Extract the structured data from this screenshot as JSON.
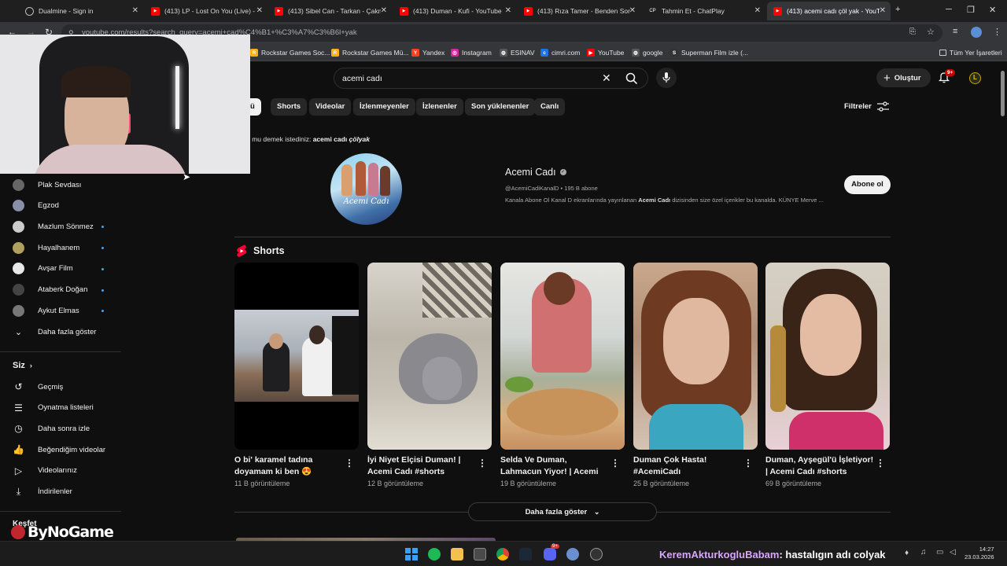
{
  "browser": {
    "tabs": [
      {
        "title": "Dualmine - Sign in",
        "favicon": "globe-icon",
        "active": false
      },
      {
        "title": "(413) LP - Lost On You (Live) - Y",
        "favicon": "youtube-icon",
        "active": false
      },
      {
        "title": "(413) Sibel Can - Tarkan - Çakm",
        "favicon": "youtube-icon",
        "active": false
      },
      {
        "title": "(413) Duman - Kufi - YouTube",
        "favicon": "youtube-icon",
        "active": false
      },
      {
        "title": "(413) Rıza Tamer - Benden Son",
        "favicon": "youtube-icon",
        "active": false
      },
      {
        "title": "Tahmin Et - ChatPlay",
        "favicon": "chatplay-icon",
        "favicon_text": "CP",
        "active": false
      },
      {
        "title": "(413) acemi cadı çöl yak - YouT",
        "favicon": "youtube-icon",
        "active": true
      }
    ],
    "url": "youtube.com/results?search_query=acemi+cad%C4%B1+%C3%A7%C3%B6l+yak",
    "bookmarks": [
      {
        "label": "Rockstar Games Soc...",
        "icon": "rockstar-icon",
        "icon_text": "R",
        "color": "#fcaf17"
      },
      {
        "label": "Rockstar Games Mü...",
        "icon": "rockstar-icon",
        "icon_text": "R",
        "color": "#fcaf17"
      },
      {
        "label": "Yandex",
        "icon": "yandex-icon",
        "icon_text": "Y",
        "color": "#fc3f1d"
      },
      {
        "label": "Instagram",
        "icon": "instagram-icon",
        "icon_text": "◎",
        "color": "#d6249f"
      },
      {
        "label": "ESINAV",
        "icon": "globe-icon",
        "icon_text": "◍",
        "color": "#555555"
      },
      {
        "label": "cimri.com",
        "icon": "cimri-icon",
        "icon_text": "c",
        "color": "#1a73e8"
      },
      {
        "label": "YouTube",
        "icon": "youtube-icon",
        "icon_text": "▶",
        "color": "#ff0000"
      },
      {
        "label": "google",
        "icon": "globe-icon",
        "icon_text": "◍",
        "color": "#555555"
      },
      {
        "label": "Superman Film izle (...",
        "icon": "superman-icon",
        "icon_text": "S",
        "color": "#333333"
      }
    ],
    "all_bookmarks": "Tüm Yer İşaretleri"
  },
  "youtube": {
    "search_query": "acemi cadı",
    "create_label": "Oluştur",
    "notif_badge": "9+",
    "filters": [
      {
        "label": "Tümü",
        "selected": true
      },
      {
        "label": "Shorts"
      },
      {
        "label": "Videolar"
      },
      {
        "label": "İzlenmeyenler"
      },
      {
        "label": "İzlenenler"
      },
      {
        "label": "Son yüklenenler"
      },
      {
        "label": "Canlı"
      }
    ],
    "filters_button": "Filtreler",
    "did_you_mean_prefix": "Bunu mu demek istediniz: ",
    "did_you_mean_plain": "acemi cadı ",
    "did_you_mean_italic": "çölyak",
    "channel": {
      "name": "Acemi Cadı",
      "handle_line": "@AcemiCadiKanalD • 195 B abone",
      "desc_before": "Kanala Abone Ol Kanal D ekranlarında yayınlanan ",
      "desc_bold": "Acemi Cadı",
      "desc_after": " dizisinden size özel içerikler bu kanalda. KÜNYE Merve ...",
      "subscribe_label": "Abone ol",
      "avatar_text": "Acemi Cadı"
    },
    "shorts_header": "Shorts",
    "shorts": [
      {
        "title": "O bi' karamel tadına doyamam ki ben 😍 Acem...",
        "views": "11 B görüntüleme"
      },
      {
        "title": "İyi Niyet Elçisi Duman! | Acemi Cadı #shorts",
        "views": "12 B görüntüleme"
      },
      {
        "title": "Selda Ve Duman, Lahmacun Yiyor! | Acemi Cadı #shorts",
        "views": "19 B görüntüleme"
      },
      {
        "title": "Duman Çok Hasta! #AcemiCadı",
        "views": "25 B görüntüleme"
      },
      {
        "title": "Duman, Ayşegül'ü İşletiyor! | Acemi Cadı #shorts",
        "views": "69 B görüntüleme"
      }
    ],
    "show_more": "Daha fazla göster",
    "sidebar": {
      "subscriptions": [
        {
          "name": "Plak Sevdası",
          "color": "#666666",
          "new": false
        },
        {
          "name": "Egzod",
          "color": "#8a8fa8",
          "new": false
        },
        {
          "name": "Mazlum Sönmez",
          "color": "#cccccc",
          "new": true
        },
        {
          "name": "Hayalhanem",
          "color": "#b0a060",
          "new": true
        },
        {
          "name": "Avşar Film",
          "color": "#e8e8e8",
          "new": true
        },
        {
          "name": "Ataberk Doğan",
          "color": "#444444",
          "new": true
        },
        {
          "name": "Aykut Elmas",
          "color": "#777777",
          "new": true
        }
      ],
      "show_more": "Daha fazla göster",
      "you_header": "Siz",
      "you_items": [
        {
          "label": "Geçmiş",
          "icon": "history-icon"
        },
        {
          "label": "Oynatma listeleri",
          "icon": "playlist-icon"
        },
        {
          "label": "Daha sonra izle",
          "icon": "clock-icon"
        },
        {
          "label": "Beğendiğim videolar",
          "icon": "thumbs-up-icon"
        },
        {
          "label": "Videolarınız",
          "icon": "video-icon"
        },
        {
          "label": "İndirilenler",
          "icon": "download-icon"
        }
      ],
      "explore_header": "Keşfet"
    }
  },
  "overlay": {
    "watermark": "ByNoGame",
    "chat_user": "KeremAkturkogluBabam",
    "chat_message": ": hastalıgın adı colyak"
  },
  "taskbar": {
    "time": "14:27",
    "date": "23.03.2026",
    "discord_badge": "9+"
  }
}
